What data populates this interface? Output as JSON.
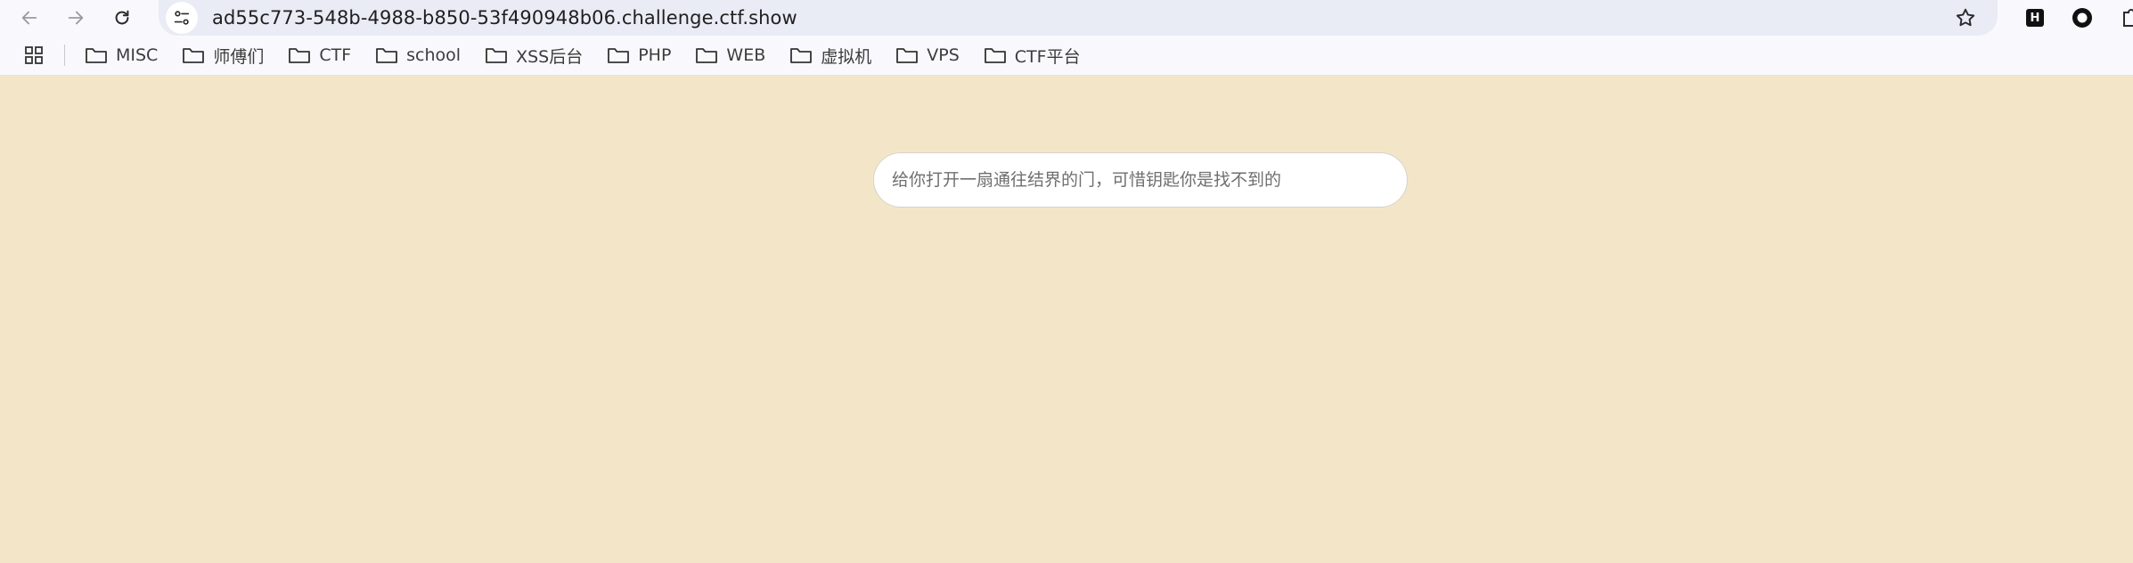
{
  "browser": {
    "url": "ad55c773-548b-4988-b850-53f490948b06.challenge.ctf.show",
    "extensions": {
      "h_label": "H"
    }
  },
  "bookmarks": [
    {
      "label": "MISC"
    },
    {
      "label": "师傅们"
    },
    {
      "label": "CTF"
    },
    {
      "label": "school"
    },
    {
      "label": "XSS后台"
    },
    {
      "label": "PHP"
    },
    {
      "label": "WEB"
    },
    {
      "label": "虚拟机"
    },
    {
      "label": "VPS"
    },
    {
      "label": "CTF平台"
    }
  ],
  "page": {
    "background": "#f3e6c8",
    "input": {
      "value": "",
      "placeholder": "给你打开一扇通往结界的门，可惜钥匙你是找不到的"
    }
  }
}
